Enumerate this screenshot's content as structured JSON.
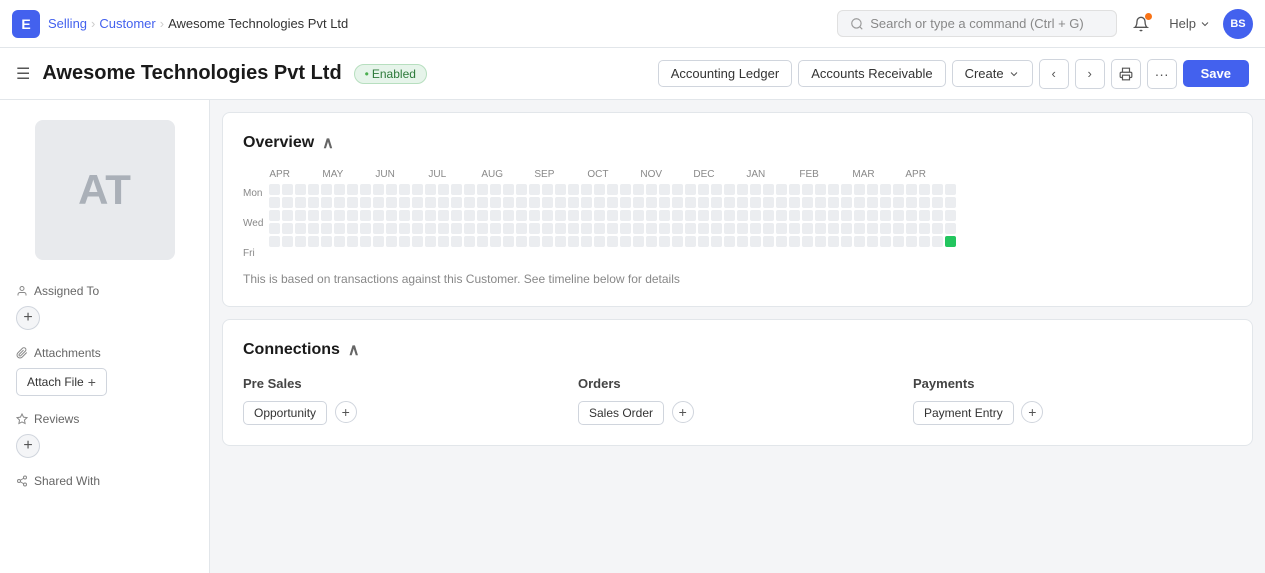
{
  "topbar": {
    "app_icon": "E",
    "breadcrumbs": [
      "Selling",
      "Customer",
      "Awesome Technologies Pvt Ltd"
    ],
    "search_placeholder": "Search or type a command (Ctrl + G)",
    "help_label": "Help",
    "avatar_text": "BS"
  },
  "page_header": {
    "title": "Awesome Technologies Pvt Ltd",
    "status": "Enabled",
    "buttons": {
      "accounting_ledger": "Accounting Ledger",
      "accounts_receivable": "Accounts Receivable",
      "create": "Create",
      "save": "Save"
    }
  },
  "sidebar": {
    "avatar_initials": "AT",
    "assigned_to_label": "Assigned To",
    "attachments_label": "Attachments",
    "attach_file_label": "Attach File",
    "reviews_label": "Reviews",
    "shared_with_label": "Shared With"
  },
  "overview": {
    "title": "Overview",
    "note": "This is based on transactions against this Customer. See timeline below for details",
    "months": [
      "APR",
      "MAY",
      "JUN",
      "JUL",
      "AUG",
      "SEP",
      "OCT",
      "NOV",
      "DEC",
      "JAN",
      "FEB",
      "MAR",
      "APR"
    ],
    "day_labels": [
      "Mon",
      "Wed",
      "Fri"
    ]
  },
  "connections": {
    "title": "Connections",
    "pre_sales": {
      "label": "Pre Sales",
      "items": [
        "Opportunity"
      ]
    },
    "orders": {
      "label": "Orders",
      "items": [
        "Sales Order"
      ]
    },
    "payments": {
      "label": "Payments",
      "items": [
        "Payment Entry"
      ]
    }
  }
}
